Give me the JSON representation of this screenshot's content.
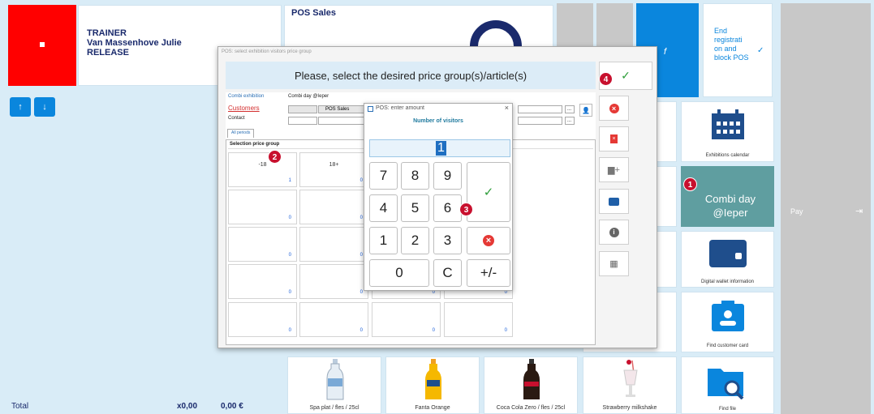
{
  "header": {
    "user_role": "TRAINER",
    "user_name": "Van Massenhove Julie",
    "release_label": "RELEASE",
    "pos_sales_title": "POS Sales"
  },
  "end_tile": {
    "label": "End registrati on and block POS",
    "f_label": "f"
  },
  "right_tiles": {
    "exhibitions_calendar": "Exhibitions calendar",
    "combi_day": "Combi day @Ieper",
    "digital_wallet": "Digital wallet information",
    "find_customer_card": "Find customer card",
    "find_file": "Find file"
  },
  "pay": {
    "label": "Pay"
  },
  "footer": {
    "total_label": "Total",
    "quantity": "x0,00",
    "amount": "0,00 €"
  },
  "products": [
    {
      "label": "Spa plat / fles / 25cl"
    },
    {
      "label": "Fanta Orange"
    },
    {
      "label": "Coca Cola Zero / fles / 25cl"
    },
    {
      "label": "Strawberry milkshake"
    }
  ],
  "price_dialog": {
    "title": "POS: select exhibition visitors price group",
    "banner": "Please, select the desired price group(s)/article(s)",
    "combi_label": "Combi exhibition",
    "combi_value": "Combi day @Ieper",
    "customers_label": "Customers",
    "customers_value": "POS Sales",
    "contact_label": "Contact",
    "tab_all_periods": "All periods",
    "section_title": "Selection price group",
    "groups": [
      {
        "name": "-18",
        "count": "1"
      },
      {
        "name": "18+",
        "count": "0"
      },
      {
        "name": "",
        "count": "0"
      },
      {
        "name": "",
        "count": "0"
      },
      {
        "name": "",
        "count": "0"
      },
      {
        "name": "",
        "count": "0"
      },
      {
        "name": "",
        "count": "0"
      },
      {
        "name": "",
        "count": "0"
      },
      {
        "name": "",
        "count": "0"
      },
      {
        "name": "",
        "count": "0"
      },
      {
        "name": "",
        "count": "0"
      },
      {
        "name": "",
        "count": "0"
      },
      {
        "name": "",
        "count": "0"
      },
      {
        "name": "",
        "count": "0"
      }
    ],
    "ellipsis": "..."
  },
  "amount_dialog": {
    "title": "POS: enter amount",
    "subtitle": "Number of visitors",
    "value": "1",
    "close": "×",
    "keys": [
      "7",
      "8",
      "9",
      "4",
      "5",
      "6",
      "1",
      "2",
      "3",
      "0",
      "C",
      "+/-"
    ]
  },
  "badges": [
    "1",
    "2",
    "3",
    "4"
  ],
  "colors": {
    "accent_blue": "#0a86dd",
    "red_tile": "#ff0000",
    "combi_teal": "#5f9ea0",
    "badge_red": "#c8102e",
    "ok_green": "#2e9e3a",
    "cancel_red": "#e53935",
    "icon_navy": "#1f4e8c"
  }
}
